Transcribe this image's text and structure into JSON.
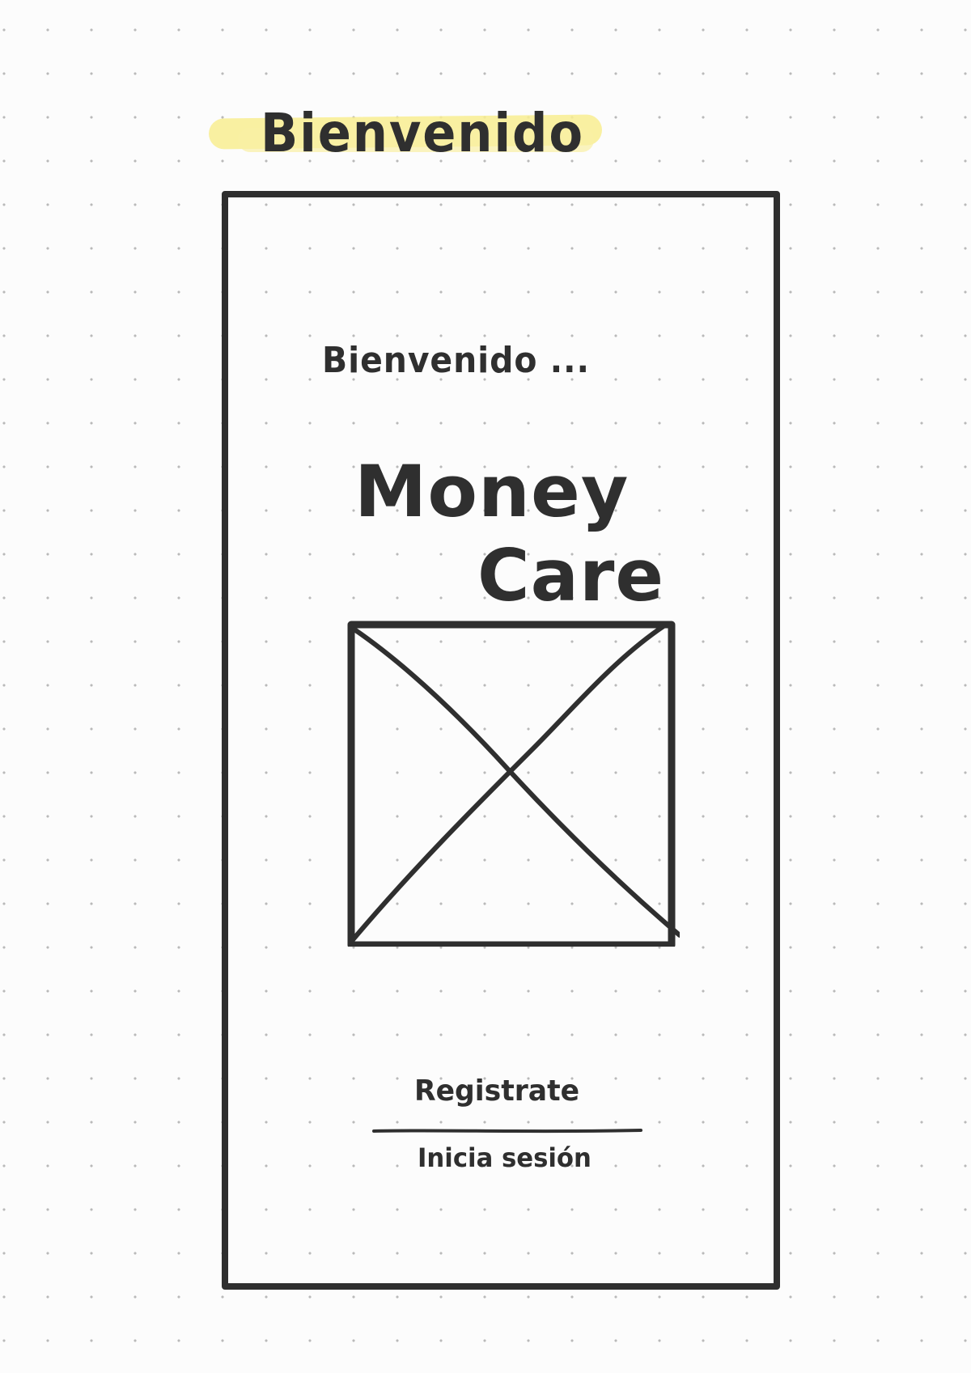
{
  "page": {
    "heading": "Bienvenido"
  },
  "screen": {
    "welcome": "Bienvenido ...",
    "app_name": {
      "line1": "Money",
      "line2": "Care"
    },
    "image_placeholder_icon": "crossed-box-image-placeholder",
    "register_label": "Registrate",
    "login_label": "Inicia sesión"
  },
  "colors": {
    "ink": "#2f2f2f",
    "highlighter": "#f8ed91",
    "paper": "#fcfcfc",
    "dot_grid": "#b9b9b9"
  }
}
